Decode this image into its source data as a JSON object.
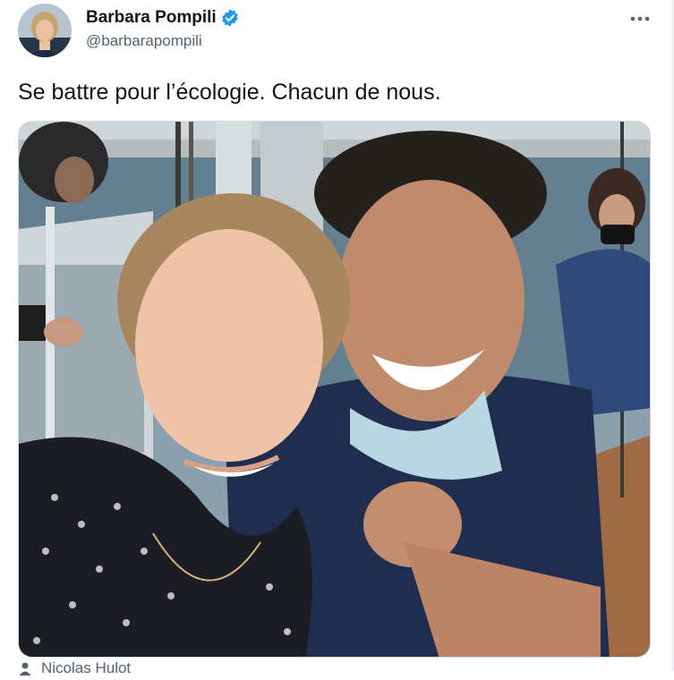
{
  "author": {
    "display_name": "Barbara Pompili",
    "handle": "@barbarapompili",
    "avatar_icon": "avatar-photo",
    "verified_icon": "verified-badge-icon",
    "verified_color": "#1d9bf0"
  },
  "tweet": {
    "text": "Se battre pour l’écologie. Chacun de nous."
  },
  "media": {
    "type": "photo"
  },
  "tagged": {
    "icon": "person-icon",
    "text": "Nicolas Hulot"
  },
  "menu": {
    "icon": "more-horizontal-icon"
  }
}
